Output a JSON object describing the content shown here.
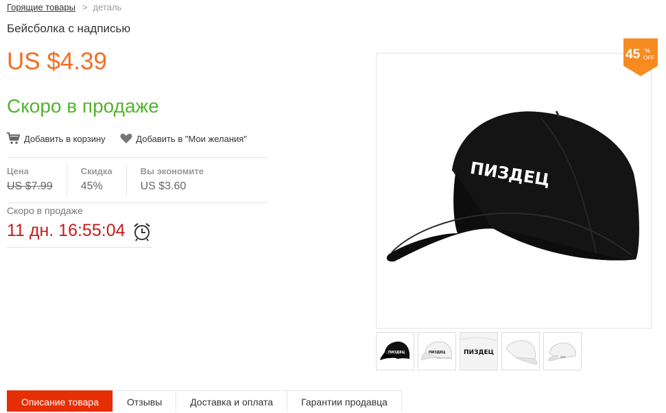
{
  "breadcrumb": {
    "link": "Горящие товары",
    "separator": ">",
    "current": "деталь"
  },
  "product": {
    "title": "Бейсболка с надписью",
    "price": "US $4.39",
    "status": "Скоро в продаже"
  },
  "actions": {
    "cart": "Добавить в корзину",
    "wishlist": "Добавить в \"Мои желания\""
  },
  "stats": [
    {
      "label": "Цена",
      "value": "US $7.99"
    },
    {
      "label": "Скидка",
      "value": "45%"
    },
    {
      "label": "Вы экономите",
      "value": "US $3.60"
    }
  ],
  "countdown": {
    "label": "Скоро в продаже",
    "value": "11 дн. 16:55:04"
  },
  "badge": {
    "number": "45",
    "percent": "%",
    "off": "OFF",
    "color": "#f78b1f"
  },
  "image": {
    "cap_text": "ПИЗДЕЦ"
  },
  "thumbs": [
    {
      "style": "black",
      "text": "ПИЗДЕЦ"
    },
    {
      "style": "white",
      "text": "ПИЗДЕЦ"
    },
    {
      "style": "closeup",
      "text": "ПИЗДЕЦ"
    },
    {
      "style": "white-side",
      "text": ""
    },
    {
      "style": "white-back",
      "text": ""
    }
  ],
  "tabs": [
    "Описание товара",
    "Отзывы",
    "Доставка и оплата",
    "Гарантии продавца"
  ],
  "colors": {
    "accent": "#f36d21",
    "green": "#52b32c",
    "timer": "#c51b1b",
    "tab_active": "#e62e04"
  }
}
